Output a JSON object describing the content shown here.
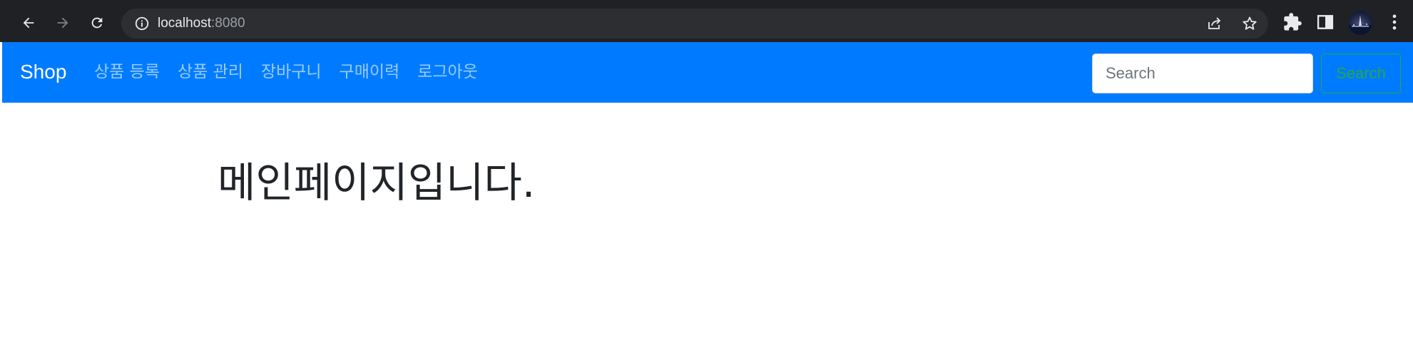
{
  "browser": {
    "url_host": "localhost",
    "url_port": ":8080",
    "icons": {
      "back": "arrow-left-icon",
      "forward": "arrow-right-icon",
      "reload": "reload-icon",
      "site_info": "info-icon",
      "share": "share-icon",
      "bookmark": "star-icon",
      "extensions": "puzzle-icon",
      "side_panel": "side-panel-icon",
      "menu": "kebab-menu-icon"
    }
  },
  "navbar": {
    "brand": "Shop",
    "links": [
      {
        "label": "상품 등록"
      },
      {
        "label": "상품 관리"
      },
      {
        "label": "장바구니"
      },
      {
        "label": "구매이력"
      },
      {
        "label": "로그아웃"
      }
    ],
    "search": {
      "placeholder": "Search",
      "button_label": "Search"
    },
    "colors": {
      "background": "#007bff",
      "search_button": "#28a745"
    }
  },
  "main": {
    "heading": "메인페이지입니다."
  }
}
